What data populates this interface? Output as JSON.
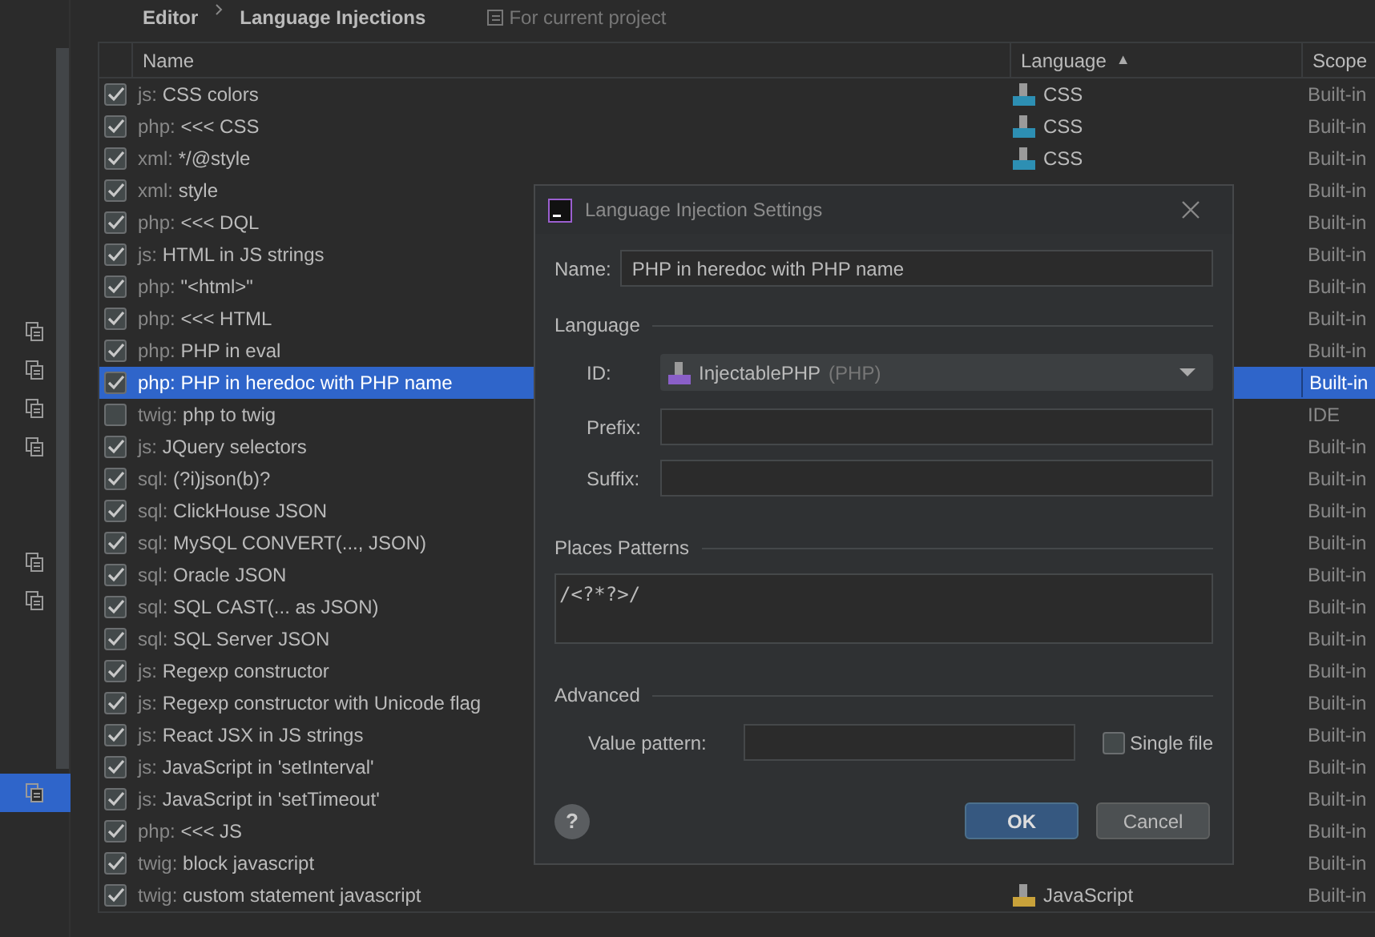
{
  "breadcrumb": {
    "items": [
      "Editor",
      "Language Injections"
    ],
    "scope_note": "For current project"
  },
  "sidebar": {
    "groups": [
      {
        "items": [
          {
            "selected": false
          },
          {
            "selected": false
          },
          {
            "selected": false
          },
          {
            "selected": false
          }
        ]
      },
      {
        "items": [
          {
            "selected": false
          },
          {
            "selected": false
          }
        ]
      },
      {
        "items": [
          {
            "selected": true
          }
        ]
      }
    ]
  },
  "table": {
    "columns": [
      {
        "label": "Name"
      },
      {
        "label": "Language",
        "sort_indicator": "▲"
      },
      {
        "label": "Scope"
      }
    ],
    "rows": [
      {
        "checked": true,
        "selected": false,
        "prefix": "js:",
        "name": "CSS colors",
        "language": {
          "kind": "css",
          "label": "CSS"
        },
        "scope": "Built-in"
      },
      {
        "checked": true,
        "selected": false,
        "prefix": "php:",
        "name": "<<< CSS",
        "language": {
          "kind": "css",
          "label": "CSS"
        },
        "scope": "Built-in"
      },
      {
        "checked": true,
        "selected": false,
        "prefix": "xml:",
        "name": "*/@style",
        "language": {
          "kind": "css",
          "label": "CSS"
        },
        "scope": "Built-in"
      },
      {
        "checked": true,
        "selected": false,
        "prefix": "xml:",
        "name": "style",
        "scope": "Built-in"
      },
      {
        "checked": true,
        "selected": false,
        "prefix": "php:",
        "name": "<<< DQL",
        "scope": "Built-in"
      },
      {
        "checked": true,
        "selected": false,
        "prefix": "js:",
        "name": "HTML in JS strings",
        "scope": "Built-in"
      },
      {
        "checked": true,
        "selected": false,
        "prefix": "php:",
        "name": "\"<html>\"",
        "scope": "Built-in"
      },
      {
        "checked": true,
        "selected": false,
        "prefix": "php:",
        "name": "<<< HTML",
        "scope": "Built-in"
      },
      {
        "checked": true,
        "selected": false,
        "prefix": "php:",
        "name": "PHP in eval",
        "scope": "Built-in"
      },
      {
        "checked": true,
        "selected": true,
        "prefix": "php:",
        "name": "PHP in heredoc with PHP name",
        "scope": "Built-in"
      },
      {
        "checked": false,
        "selected": false,
        "prefix": "twig:",
        "name": "php to twig",
        "scope": "IDE"
      },
      {
        "checked": true,
        "selected": false,
        "prefix": "js:",
        "name": "JQuery selectors",
        "scope": "Built-in"
      },
      {
        "checked": true,
        "selected": false,
        "prefix": "sql:",
        "name": "(?i)json(b)?",
        "scope": "Built-in"
      },
      {
        "checked": true,
        "selected": false,
        "prefix": "sql:",
        "name": "ClickHouse JSON",
        "scope": "Built-in"
      },
      {
        "checked": true,
        "selected": false,
        "prefix": "sql:",
        "name": "MySQL CONVERT(..., JSON)",
        "scope": "Built-in"
      },
      {
        "checked": true,
        "selected": false,
        "prefix": "sql:",
        "name": "Oracle JSON",
        "scope": "Built-in"
      },
      {
        "checked": true,
        "selected": false,
        "prefix": "sql:",
        "name": "SQL CAST(... as JSON)",
        "scope": "Built-in"
      },
      {
        "checked": true,
        "selected": false,
        "prefix": "sql:",
        "name": "SQL Server JSON",
        "scope": "Built-in"
      },
      {
        "checked": true,
        "selected": false,
        "prefix": "js:",
        "name": "Regexp constructor",
        "scope": "Built-in"
      },
      {
        "checked": true,
        "selected": false,
        "prefix": "js:",
        "name": "Regexp constructor with Unicode flag",
        "scope": "Built-in"
      },
      {
        "checked": true,
        "selected": false,
        "prefix": "js:",
        "name": "React JSX in JS strings",
        "scope": "Built-in"
      },
      {
        "checked": true,
        "selected": false,
        "prefix": "js:",
        "name": "JavaScript in 'setInterval'",
        "scope": "Built-in"
      },
      {
        "checked": true,
        "selected": false,
        "prefix": "js:",
        "name": "JavaScript in 'setTimeout'",
        "scope": "Built-in"
      },
      {
        "checked": true,
        "selected": false,
        "prefix": "php:",
        "name": "<<< JS",
        "scope": "Built-in"
      },
      {
        "checked": true,
        "selected": false,
        "prefix": "twig:",
        "name": "block javascript",
        "scope": "Built-in"
      },
      {
        "checked": true,
        "selected": false,
        "prefix": "twig:",
        "name": "custom statement javascript",
        "language": {
          "kind": "js",
          "label": "JavaScript"
        },
        "scope": "Built-in"
      }
    ]
  },
  "dialog": {
    "title": "Language Injection Settings",
    "name_field": {
      "label": "Name:",
      "value": "PHP in heredoc with PHP name"
    },
    "language": {
      "title": "Language",
      "id": {
        "label": "ID:",
        "value": "InjectablePHP",
        "hint": "(PHP)",
        "kind": "php"
      },
      "prefix": {
        "label": "Prefix:"
      },
      "suffix": {
        "label": "Suffix:"
      }
    },
    "places_patterns": {
      "title": "Places Patterns",
      "value": "/<?*?>/"
    },
    "advanced": {
      "title": "Advanced",
      "value_pattern": {
        "label": "Value pattern:"
      },
      "single_file": {
        "label": "Single file",
        "checked": false
      }
    },
    "help": "?",
    "buttons": [
      {
        "label": "OK",
        "kind": "primary"
      },
      {
        "label": "Cancel",
        "kind": "secondary"
      }
    ]
  }
}
